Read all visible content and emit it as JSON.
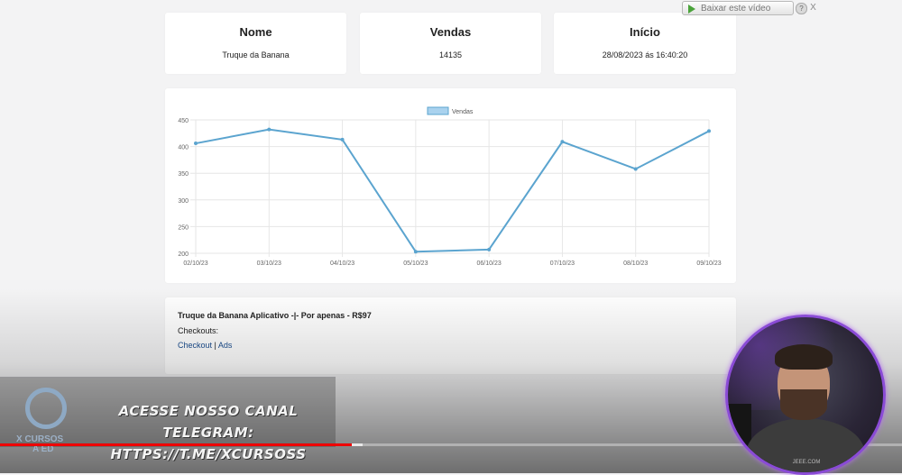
{
  "stats": {
    "nome": {
      "title": "Nome",
      "value": "Truque da Banana"
    },
    "vendas": {
      "title": "Vendas",
      "value": "14135"
    },
    "inicio": {
      "title": "Início",
      "value": "28/08/2023 ás 16:40:20"
    }
  },
  "chart_data": {
    "type": "line",
    "categories": [
      "02/10/23",
      "03/10/23",
      "04/10/23",
      "05/10/23",
      "06/10/23",
      "07/10/23",
      "08/10/23",
      "09/10/23"
    ],
    "series": [
      {
        "name": "Vendas",
        "values": [
          406,
          432,
          413,
          203,
          207,
          409,
          358,
          429
        ],
        "color": "#5ba4cf"
      }
    ],
    "y_ticks": [
      "450",
      "400",
      "350",
      "300",
      "250",
      "200"
    ],
    "ylim": [
      200,
      450
    ],
    "legend_position": "top",
    "grid": true
  },
  "product": {
    "title": "Truque da Banana Aplicativo -|- Por apenas - R$97",
    "checkouts_label": "Checkouts:",
    "link_checkout": "Checkout",
    "separator": "|",
    "link_ads": "Ads"
  },
  "overlay": {
    "download_label": "Baixar este vídeo",
    "help_label": "?",
    "close_label": "X"
  },
  "video": {
    "banner_line1": "ACESSE NOSSO CANAL TELEGRAM:",
    "banner_line2": "HTTPS://T.ME/XCURSOSS",
    "logo_line1": "X CURSOS",
    "logo_line2": "A ED",
    "progress_fraction": 0.39,
    "webcam_shirt_text": "JEEE.COM"
  }
}
